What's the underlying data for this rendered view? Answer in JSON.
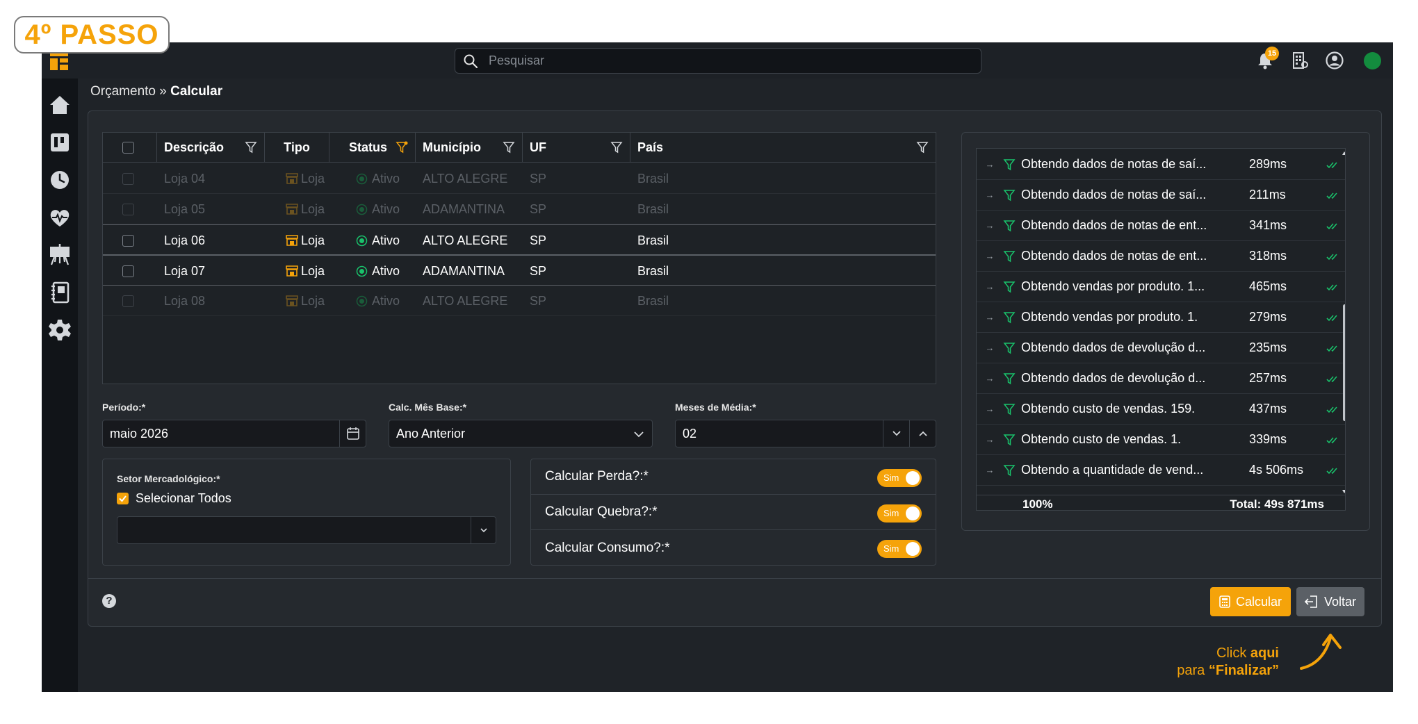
{
  "step_badge": "4º PASSO",
  "search": {
    "placeholder": "Pesquisar"
  },
  "notifications": {
    "count": "15"
  },
  "breadcrumb": {
    "parent": "Orçamento",
    "separator": " » ",
    "current": "Calcular"
  },
  "grid": {
    "columns": [
      "Descrição",
      "Tipo",
      "Status",
      "Município",
      "UF",
      "País"
    ],
    "rows": [
      {
        "descricao": "Loja 04",
        "tipo": "Loja",
        "status": "Ativo",
        "municipio": "ALTO ALEGRE",
        "uf": "SP",
        "pais": "Brasil",
        "enabled": false
      },
      {
        "descricao": "Loja 05",
        "tipo": "Loja",
        "status": "Ativo",
        "municipio": "ADAMANTINA",
        "uf": "SP",
        "pais": "Brasil",
        "enabled": false
      },
      {
        "descricao": "Loja 06",
        "tipo": "Loja",
        "status": "Ativo",
        "municipio": "ALTO ALEGRE",
        "uf": "SP",
        "pais": "Brasil",
        "enabled": true
      },
      {
        "descricao": "Loja 07",
        "tipo": "Loja",
        "status": "Ativo",
        "municipio": "ADAMANTINA",
        "uf": "SP",
        "pais": "Brasil",
        "enabled": true
      },
      {
        "descricao": "Loja 08",
        "tipo": "Loja",
        "status": "Ativo",
        "municipio": "ALTO ALEGRE",
        "uf": "SP",
        "pais": "Brasil",
        "enabled": false
      }
    ]
  },
  "form": {
    "periodo_label": "Período:*",
    "periodo_value": "maio 2026",
    "calc_mes_base_label": "Calc. Mês Base:*",
    "calc_mes_base_value": "Ano Anterior",
    "meses_media_label": "Meses de Média:*",
    "meses_media_value": "02",
    "setor_label": "Setor Mercadológico:*",
    "selecionar_todos": "Selecionar Todos",
    "calcular_perda": "Calcular Perda?:*",
    "calcular_quebra": "Calcular Quebra?:*",
    "calcular_consumo": "Calcular Consumo?:*",
    "toggle_label": "Sim"
  },
  "log": {
    "rows": [
      {
        "text": "Obtendo dados de notas de saí...",
        "time": "289ms"
      },
      {
        "text": "Obtendo dados de notas de saí...",
        "time": "211ms"
      },
      {
        "text": "Obtendo dados de notas de ent...",
        "time": "341ms"
      },
      {
        "text": "Obtendo dados de notas de ent...",
        "time": "318ms"
      },
      {
        "text": "Obtendo vendas por produto. 1...",
        "time": "465ms"
      },
      {
        "text": "Obtendo vendas por produto. 1.",
        "time": "279ms"
      },
      {
        "text": "Obtendo dados de devolução d...",
        "time": "235ms"
      },
      {
        "text": "Obtendo dados de devolução d...",
        "time": "257ms"
      },
      {
        "text": "Obtendo custo de vendas. 159.",
        "time": "437ms"
      },
      {
        "text": "Obtendo custo de vendas. 1.",
        "time": "339ms"
      },
      {
        "text": "Obtendo a quantidade de vend...",
        "time": "4s 506ms"
      }
    ],
    "percent": "100%",
    "total": "Total: 49s 871ms"
  },
  "footer": {
    "help": "?",
    "calcular": "Calcular",
    "voltar": "Voltar"
  },
  "hint": {
    "line1_prefix": "Click ",
    "line1_bold": "aqui",
    "line2_prefix": "para ",
    "line2_bold": "“Finalizar”"
  },
  "colors": {
    "accent": "#f5a30a",
    "success": "#19c26b",
    "background": "#1d2126",
    "panel": "#25292e"
  }
}
